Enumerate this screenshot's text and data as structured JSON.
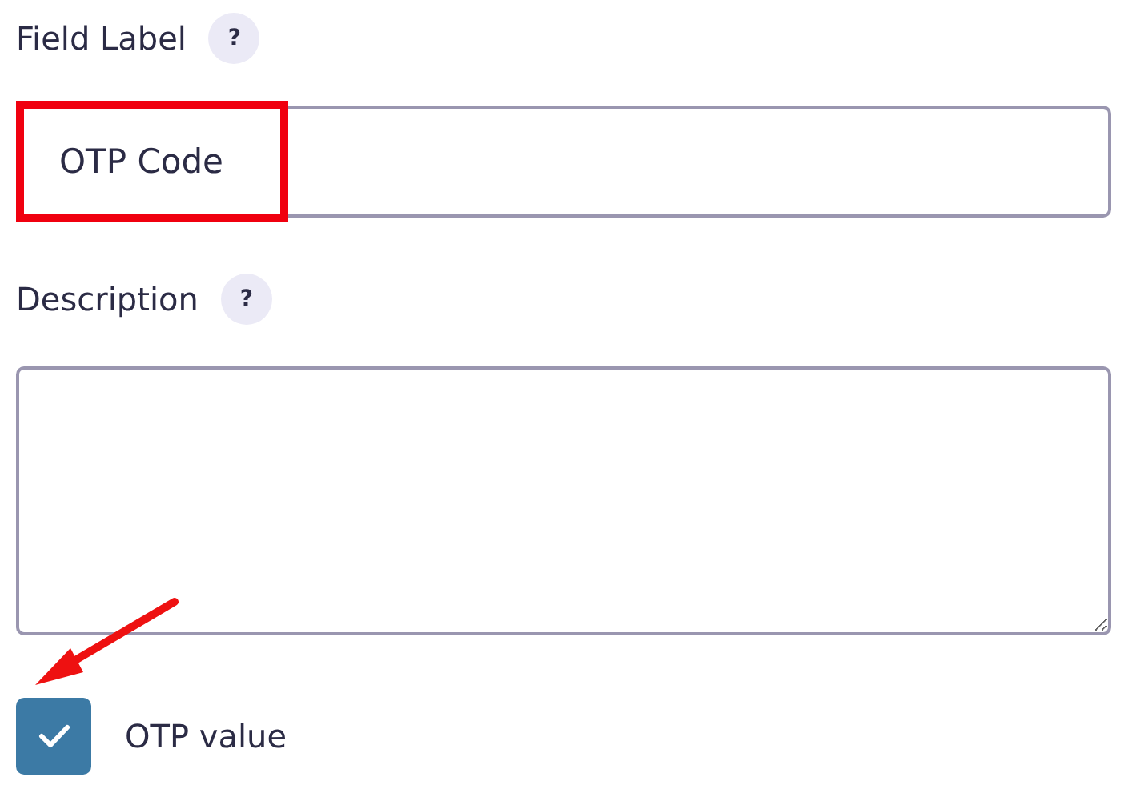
{
  "fields": [
    {
      "kind": "text",
      "label": "Field Label",
      "help": "?",
      "value": "OTP Code",
      "highlighted": true
    },
    {
      "kind": "textarea",
      "label": "Description",
      "help": "?",
      "highlighted": false
    }
  ],
  "checkbox": {
    "label": "OTP value",
    "checked": true,
    "annotated": true
  }
}
